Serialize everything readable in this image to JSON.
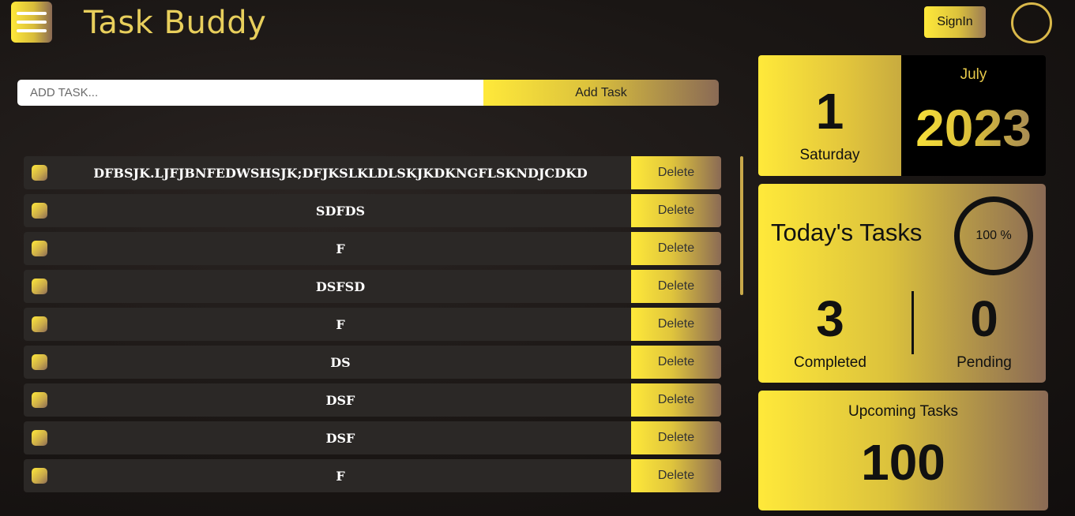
{
  "header": {
    "title": "Task Buddy",
    "signin_label": "SignIn",
    "menu_icon": "hamburger-icon",
    "profile_icon": "profile-ring-icon"
  },
  "add_task": {
    "placeholder": "ADD TASK...",
    "button_label": "Add Task"
  },
  "tasks": [
    {
      "text": "DFBSJK.LJFJBNFEDWSHSJK;DFJKSLKLDLSKJKDKNGFLSKNDJCDKD",
      "delete_label": "Delete"
    },
    {
      "text": "SDFDS",
      "delete_label": "Delete"
    },
    {
      "text": "F",
      "delete_label": "Delete"
    },
    {
      "text": "DSFSD",
      "delete_label": "Delete"
    },
    {
      "text": "F",
      "delete_label": "Delete"
    },
    {
      "text": "DS",
      "delete_label": "Delete"
    },
    {
      "text": "DSF",
      "delete_label": "Delete"
    },
    {
      "text": "DSF",
      "delete_label": "Delete"
    },
    {
      "text": "F",
      "delete_label": "Delete"
    }
  ],
  "date": {
    "day": "1",
    "weekday": "Saturday",
    "month": "July",
    "year": "2023"
  },
  "today": {
    "title": "Today's Tasks",
    "percent": "100 %",
    "completed": "3",
    "completed_label": "Completed",
    "pending": "0",
    "pending_label": "Pending"
  },
  "upcoming": {
    "title": "Upcoming Tasks",
    "count": "100"
  },
  "colors": {
    "accent_gold": "#ffe93a",
    "accent_brown": "#8a6a55",
    "background": "#1a1614"
  }
}
